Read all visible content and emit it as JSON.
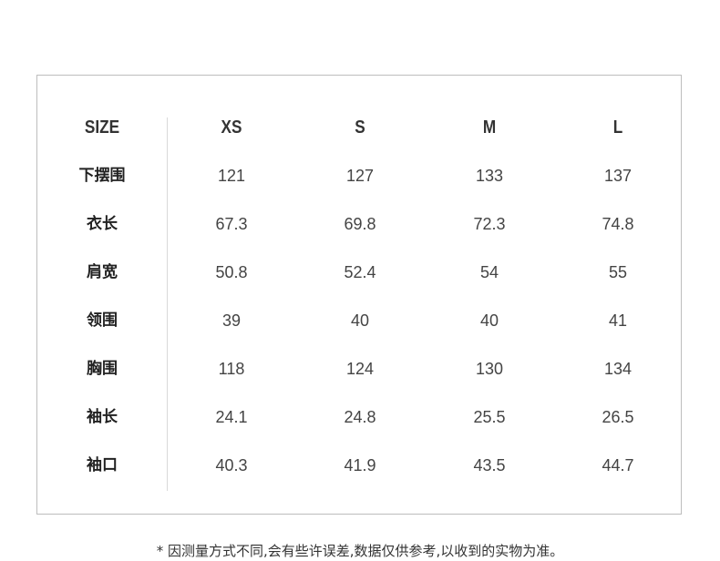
{
  "table": {
    "headers": [
      "SIZE",
      "XS",
      "S",
      "M",
      "L"
    ],
    "rows": [
      {
        "label": "下摆围",
        "values": [
          "121",
          "127",
          "133",
          "137"
        ]
      },
      {
        "label": "衣长",
        "values": [
          "67.3",
          "69.8",
          "72.3",
          "74.8"
        ]
      },
      {
        "label": "肩宽",
        "values": [
          "50.8",
          "52.4",
          "54",
          "55"
        ]
      },
      {
        "label": "领围",
        "values": [
          "39",
          "40",
          "40",
          "41"
        ]
      },
      {
        "label": "胸围",
        "values": [
          "118",
          "124",
          "130",
          "134"
        ]
      },
      {
        "label": "袖长",
        "values": [
          "24.1",
          "24.8",
          "25.5",
          "26.5"
        ]
      },
      {
        "label": "袖口",
        "values": [
          "40.3",
          "41.9",
          "43.5",
          "44.7"
        ]
      }
    ]
  },
  "footnote": "* 因测量方式不同,会有些许误差,数据仅供参考,以收到的实物为准。",
  "colors": {
    "border": "#bdbdbd",
    "divider": "#d9d9d9",
    "text": "#333333"
  }
}
